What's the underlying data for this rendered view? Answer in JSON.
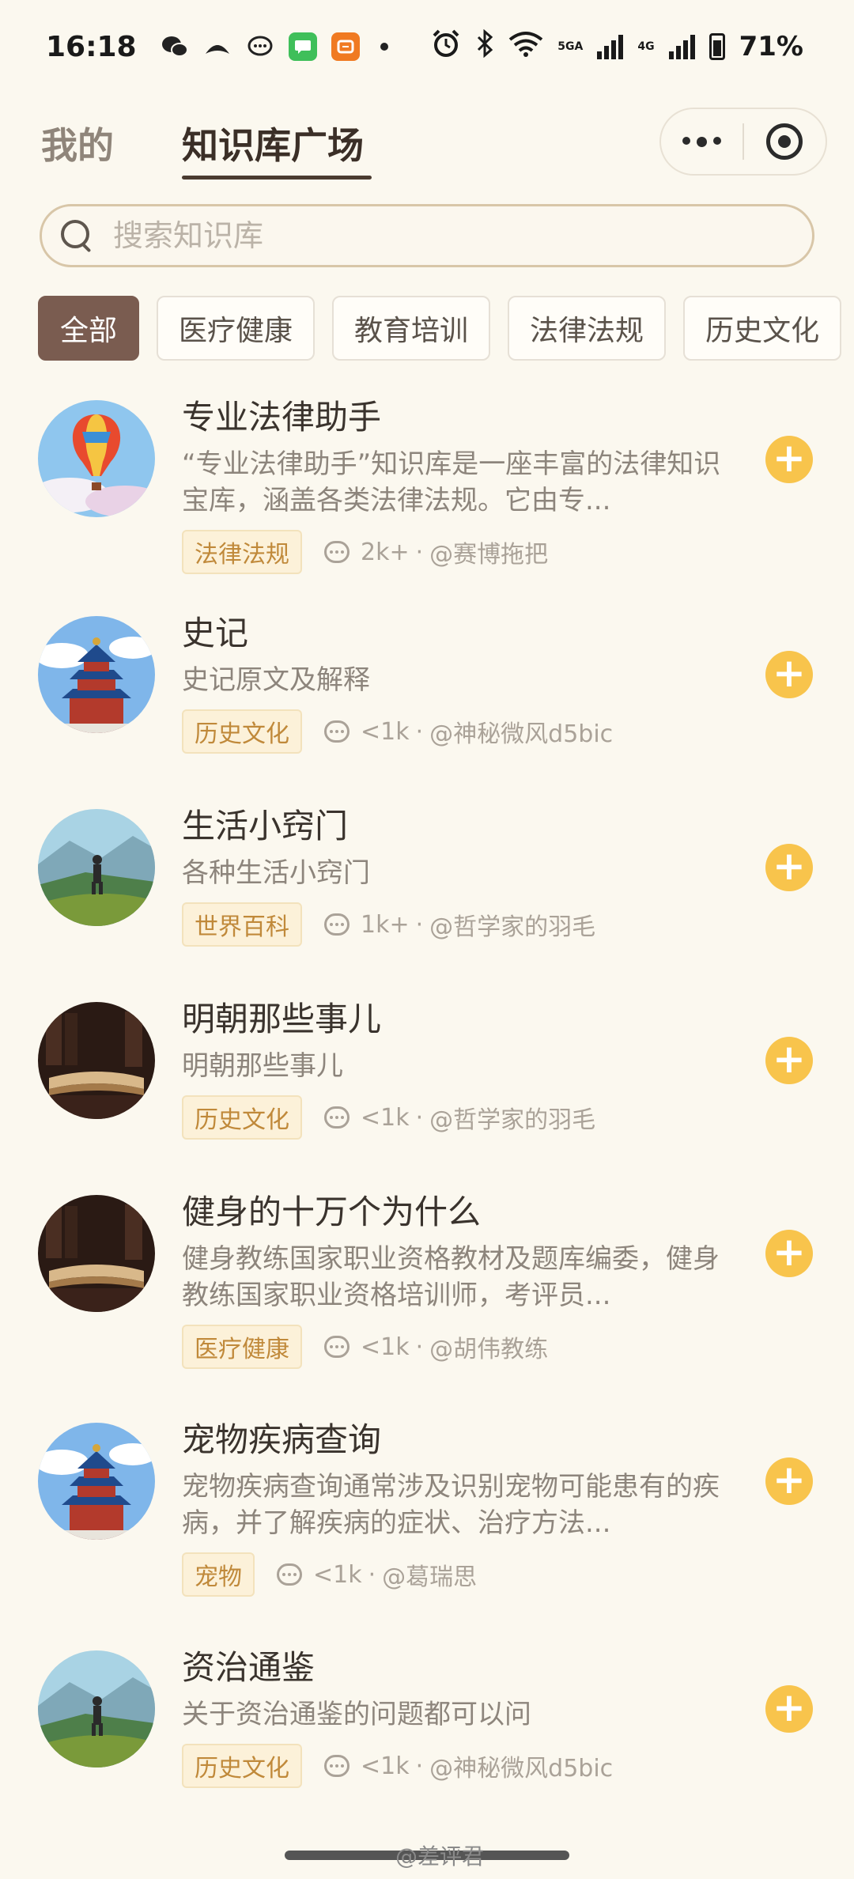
{
  "status_bar": {
    "time": "16:18",
    "net1": "5GA",
    "net2": "4G",
    "battery": "71%"
  },
  "header": {
    "tab_mine": "我的",
    "tab_square": "知识库广场"
  },
  "search": {
    "placeholder": "搜索知识库"
  },
  "categories": [
    "全部",
    "医疗健康",
    "教育培训",
    "法律法规",
    "历史文化"
  ],
  "items": [
    {
      "title": "专业法律助手",
      "desc": "“专业法律助手”知识库是一座丰富的法律知识宝库，涵盖各类法律法规。它由专...",
      "tag": "法律法规",
      "count": "2k+",
      "author": "@赛博拖把",
      "avatar_icon": "balloon-icon"
    },
    {
      "title": "史记",
      "desc": "史记原文及解释",
      "tag": "历史文化",
      "count": "<1k",
      "author": "@神秘微风d5bic",
      "avatar_icon": "temple-icon"
    },
    {
      "title": "生活小窍门",
      "desc": "各种生活小窍门",
      "tag": "世界百科",
      "count": "1k+",
      "author": "@哲学家的羽毛",
      "avatar_icon": "hiker-icon"
    },
    {
      "title": "明朝那些事儿",
      "desc": "明朝那些事儿",
      "tag": "历史文化",
      "count": "<1k",
      "author": "@哲学家的羽毛",
      "avatar_icon": "book-icon"
    },
    {
      "title": "健身的十万个为什么",
      "desc": "健身教练国家职业资格教材及题库编委，健身教练国家职业资格培训师，考评员...",
      "tag": "医疗健康",
      "count": "<1k",
      "author": "@胡伟教练",
      "avatar_icon": "book-icon"
    },
    {
      "title": "宠物疾病查询",
      "desc": "宠物疾病查询通常涉及识别宠物可能患有的疾病，并了解疾病的症状、治疗方法...",
      "tag": "宠物",
      "count": "<1k",
      "author": "@葛瑞思",
      "avatar_icon": "temple-icon"
    },
    {
      "title": "资治通鉴",
      "desc": "关于资治通鉴的问题都可以问",
      "tag": "历史文化",
      "count": "<1k",
      "author": "@神秘微风d5bic",
      "avatar_icon": "hiker-icon"
    }
  ],
  "meta_sep": "·",
  "add_symbol": "+",
  "watermark": "@差评君",
  "colors": {
    "background": "#fbf8ef",
    "accent_yellow": "#f8c44c",
    "active_chip": "#7a5c50",
    "tag_text": "#c0893a"
  }
}
